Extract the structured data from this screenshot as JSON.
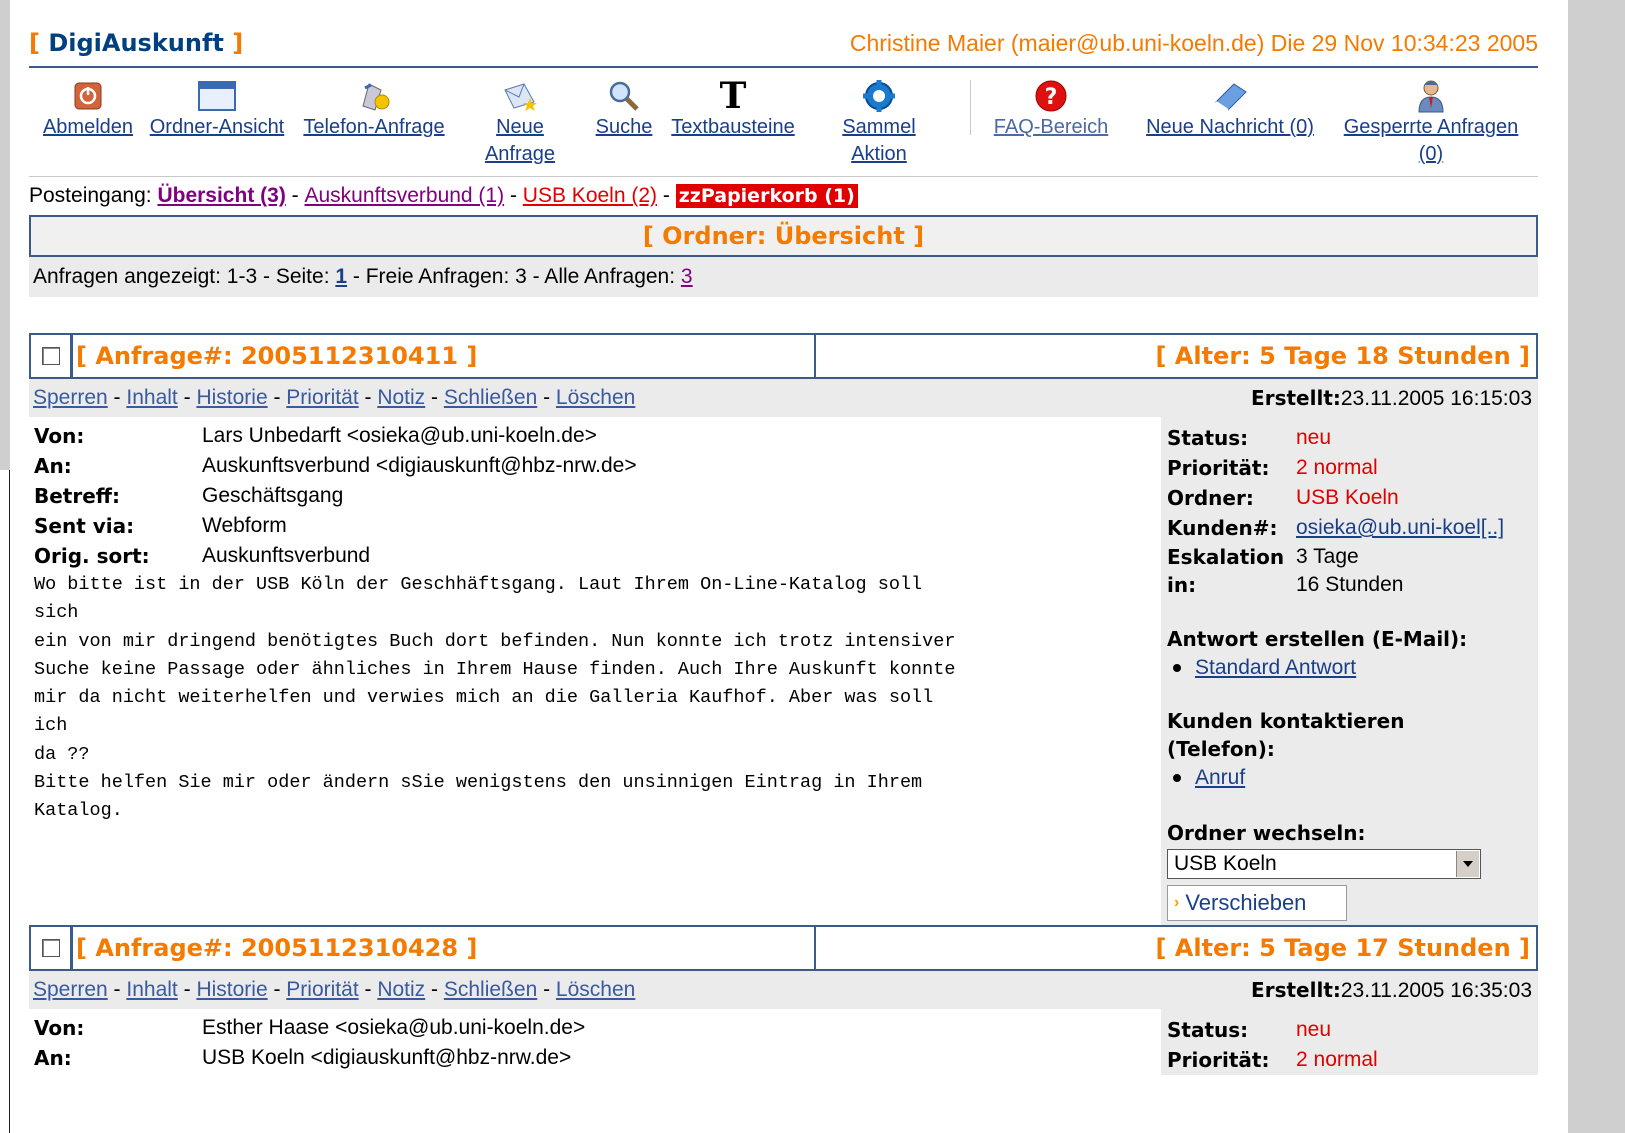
{
  "header": {
    "brand": "DigiAuskunft",
    "bracket_open": "[",
    "bracket_close": "]",
    "user_info": "Christine Maier (maier@ub.uni-koeln.de) Die 29 Nov 10:34:23 2005"
  },
  "toolbar": {
    "items": [
      {
        "line1": "Abmelden",
        "line2": "",
        "icon": "power-off-icon"
      },
      {
        "line1": "Ordner-Ansicht",
        "line2": "",
        "icon": "window-icon"
      },
      {
        "line1": "Telefon-Anfrage",
        "line2": "",
        "icon": "phone-request-icon"
      },
      {
        "line1": "Neue",
        "line2": "Anfrage",
        "icon": "new-request-icon"
      },
      {
        "line1": "Suche",
        "line2": "",
        "icon": "magnifier-icon"
      },
      {
        "line1": "Textbausteine",
        "line2": "",
        "icon": "text-t-icon"
      },
      {
        "line1": "Sammel",
        "line2": "Aktion",
        "icon": "gear-icon"
      },
      {
        "line1": "FAQ-Bereich",
        "line2": "",
        "icon": "question-icon"
      },
      {
        "line1": "Neue Nachricht (0)",
        "line2": "",
        "icon": "message-icon"
      },
      {
        "line1": "Gesperrte Anfragen",
        "line2": "(0)",
        "icon": "locked-user-icon"
      }
    ]
  },
  "folders": {
    "prefix": "Posteingang:",
    "current": "Übersicht (3)",
    "sep": "-",
    "link1": "Auskunftsverbund (1)",
    "link2": "USB Koeln (2)",
    "trash": "zzPapierkorb (1)"
  },
  "ordner_title": "[ Ordner: Übersicht ]",
  "counts": {
    "text1": "Anfragen angezeigt: 1-3 - Seite: ",
    "page": "1",
    "text2": " - Freie Anfragen: 3 - Alle Anfragen: ",
    "all": "3"
  },
  "actions": [
    "Sperren",
    "Inhalt",
    "Historie",
    "Priorität",
    "Notiz",
    "Schließen",
    "Löschen"
  ],
  "requests": [
    {
      "number": "[ Anfrage#: 2005112310411 ]",
      "age": "[ Alter: 5 Tage 18 Stunden ]",
      "created_label": "Erstellt:",
      "created": "23.11.2005 16:15:03",
      "headers": [
        {
          "k": "Von:",
          "v": "Lars Unbedarft <osieka@ub.uni-koeln.de>"
        },
        {
          "k": "An:",
          "v": "Auskunftsverbund <digiauskunft@hbz-nrw.de>"
        },
        {
          "k": "Betreff:",
          "v": "Geschäftsgang"
        },
        {
          "k": "Sent via:",
          "v": "Webform"
        },
        {
          "k": "Orig. sort:",
          "v": "Auskunftsverbund"
        }
      ],
      "message": "Wo bitte ist in der USB Köln der Geschhäftsgang. Laut Ihrem On-Line-Katalog soll\nsich\nein von mir dringend benötigtes Buch dort befinden. Nun konnte ich trotz intensiver\nSuche keine Passage oder ähnliches in Ihrem Hause finden. Auch Ihre Auskunft konnte\nmir da nicht weiterhelfen und verwies mich an die Galleria Kaufhof. Aber was soll\nich\nda ??\nBitte helfen Sie mir oder ändern sSie wenigstens den unsinnigen Eintrag in Ihrem\nKatalog.",
      "status": {
        "k": "Status:",
        "v": "neu"
      },
      "prio": {
        "k": "Priorität:",
        "v": "2 normal"
      },
      "ordner": {
        "k": "Ordner:",
        "v": "USB Koeln"
      },
      "kunde": {
        "k": "Kunden#:",
        "v": "osieka@ub.uni-koel[..]"
      },
      "esk": {
        "k1": "Eskalation",
        "k2": "in:",
        "v1": "3 Tage",
        "v2": "16 Stunden"
      },
      "reply_head": "Antwort erstellen (E-Mail):",
      "reply_link": "Standard Antwort",
      "contact_head1": "Kunden kontaktieren",
      "contact_head2": "(Telefon):",
      "contact_link": "Anruf",
      "move_head": "Ordner wechseln:",
      "move_select": "USB Koeln",
      "move_button": "Verschieben"
    },
    {
      "number": "[ Anfrage#: 2005112310428 ]",
      "age": "[ Alter: 5 Tage 17 Stunden ]",
      "created_label": "Erstellt:",
      "created": "23.11.2005 16:35:03",
      "headers": [
        {
          "k": "Von:",
          "v": "Esther Haase <osieka@ub.uni-koeln.de>"
        },
        {
          "k": "An:",
          "v": "USB Koeln <digiauskunft@hbz-nrw.de>"
        }
      ],
      "status": {
        "k": "Status:",
        "v": "neu"
      },
      "prio": {
        "k": "Priorität:",
        "v": "2 normal"
      }
    }
  ],
  "colors": {
    "accent": "#f47a00",
    "brand": "#004080",
    "border": "#3a5a8a",
    "alert": "#e00000",
    "visited": "#800080"
  }
}
